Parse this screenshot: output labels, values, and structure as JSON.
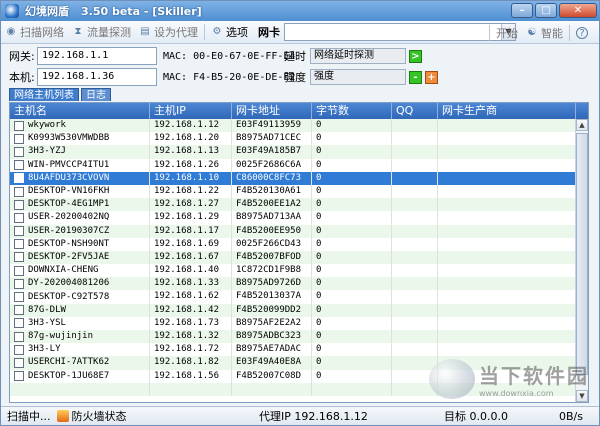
{
  "window": {
    "title": "幻境网盾",
    "version": "3.50 beta - [Skiller]",
    "min_label": "–",
    "max_label": "□",
    "close_label": "✕"
  },
  "toolbar": {
    "scan_label": "扫描网络",
    "flow_label": "流量探测",
    "proxy_label": "设为代理",
    "options_label": "选项",
    "nic_label": "网卡",
    "nic_value": "",
    "start_label": "开始",
    "smart_label": "智能",
    "help_label": "?"
  },
  "info": {
    "gateway_label": "网关:",
    "gateway_ip": "192.168.1.1",
    "gateway_mac": "MAC: 00-E0-67-0E-FF-E4",
    "local_label": "本机:",
    "local_ip": "192.168.1.36",
    "local_mac": "MAC: F4-B5-20-0E-DE-E2",
    "delay_label": "延时",
    "delay_value": "网络延时探测",
    "strength_label": "强度",
    "strength_value": "强度",
    "play_label": ">",
    "minus_label": "-",
    "plus_label": "+"
  },
  "tabs": [
    {
      "label": "网络主机列表"
    },
    {
      "label": "日志"
    }
  ],
  "grid": {
    "columns": [
      "主机名",
      "主机IP",
      "网卡地址",
      "字节数",
      "QQ",
      "网卡生产商"
    ],
    "rows": [
      {
        "name": "wkywork",
        "ip": "192.168.1.12",
        "mac": "E03F49113959",
        "bytes": "0",
        "qq": "",
        "vendor": ""
      },
      {
        "name": "K0993W530VMWDBB",
        "ip": "192.168.1.20",
        "mac": "B8975AD71CEC",
        "bytes": "0",
        "qq": "",
        "vendor": ""
      },
      {
        "name": "3H3-YZJ",
        "ip": "192.168.1.13",
        "mac": "E03F49A185B7",
        "bytes": "0",
        "qq": "",
        "vendor": ""
      },
      {
        "name": "WIN-PMVCCP4ITU1",
        "ip": "192.168.1.26",
        "mac": "0025F2686C6A",
        "bytes": "0",
        "qq": "",
        "vendor": ""
      },
      {
        "name": "8U4AFDU373CVOVN",
        "ip": "192.168.1.10",
        "mac": "C86000C8FC73",
        "bytes": "0",
        "qq": "",
        "vendor": "",
        "selected": true
      },
      {
        "name": "DESKTOP-VN16FKH",
        "ip": "192.168.1.22",
        "mac": "F4B520130A61",
        "bytes": "0",
        "qq": "",
        "vendor": ""
      },
      {
        "name": "DESKTOP-4EG1MP1",
        "ip": "192.168.1.27",
        "mac": "F4B5200EE1A2",
        "bytes": "0",
        "qq": "",
        "vendor": ""
      },
      {
        "name": "USER-20200402NQ",
        "ip": "192.168.1.29",
        "mac": "B8975AD713AA",
        "bytes": "0",
        "qq": "",
        "vendor": ""
      },
      {
        "name": "USER-20190307CZ",
        "ip": "192.168.1.17",
        "mac": "F4B5200EE950",
        "bytes": "0",
        "qq": "",
        "vendor": ""
      },
      {
        "name": "DESKTOP-NSH90NT",
        "ip": "192.168.1.69",
        "mac": "0025F266CD43",
        "bytes": "0",
        "qq": "",
        "vendor": ""
      },
      {
        "name": "DESKTOP-2FV5JAE",
        "ip": "192.168.1.67",
        "mac": "F4B52007BFOD",
        "bytes": "0",
        "qq": "",
        "vendor": ""
      },
      {
        "name": "DOWNXIA-CHENG",
        "ip": "192.168.1.40",
        "mac": "1C872CD1F9B8",
        "bytes": "0",
        "qq": "",
        "vendor": ""
      },
      {
        "name": "DY-202004081206",
        "ip": "192.168.1.33",
        "mac": "B8975AD9726D",
        "bytes": "0",
        "qq": "",
        "vendor": ""
      },
      {
        "name": "DESKTOP-C92T578",
        "ip": "192.168.1.62",
        "mac": "F4B52013037A",
        "bytes": "0",
        "qq": "",
        "vendor": ""
      },
      {
        "name": "87G-DLW",
        "ip": "192.168.1.42",
        "mac": "F4B520099DD2",
        "bytes": "0",
        "qq": "",
        "vendor": ""
      },
      {
        "name": "3H3-YSL",
        "ip": "192.168.1.73",
        "mac": "B8975AF2E2A2",
        "bytes": "0",
        "qq": "",
        "vendor": ""
      },
      {
        "name": "87g-wujinjin",
        "ip": "192.168.1.32",
        "mac": "B8975ADBC323",
        "bytes": "0",
        "qq": "",
        "vendor": ""
      },
      {
        "name": "3H3-LY",
        "ip": "192.168.1.72",
        "mac": "B8975AE7ADAC",
        "bytes": "0",
        "qq": "",
        "vendor": ""
      },
      {
        "name": "USERCHI-7ATTK62",
        "ip": "192.168.1.82",
        "mac": "E03F49A40E8A",
        "bytes": "0",
        "qq": "",
        "vendor": ""
      },
      {
        "name": "DESKTOP-1JU68E7",
        "ip": "192.168.1.56",
        "mac": "F4B52007C08D",
        "bytes": "0",
        "qq": "",
        "vendor": ""
      },
      {
        "name": "",
        "ip": "",
        "mac": "",
        "bytes": "",
        "qq": "",
        "vendor": ""
      }
    ]
  },
  "watermark": {
    "title": "当下软件园",
    "url": "www.downxia.com"
  },
  "status": {
    "scanning": "扫描中...",
    "firewall": "防火墙状态",
    "proxy_ip": "代理IP 192.168.1.12",
    "target": "目标 0.0.0.0",
    "speed": "0B/s"
  },
  "colors": {
    "header_blue": "#2f68b8",
    "selected_blue": "#2f7bd6",
    "row_green": "#eaf7ea"
  }
}
